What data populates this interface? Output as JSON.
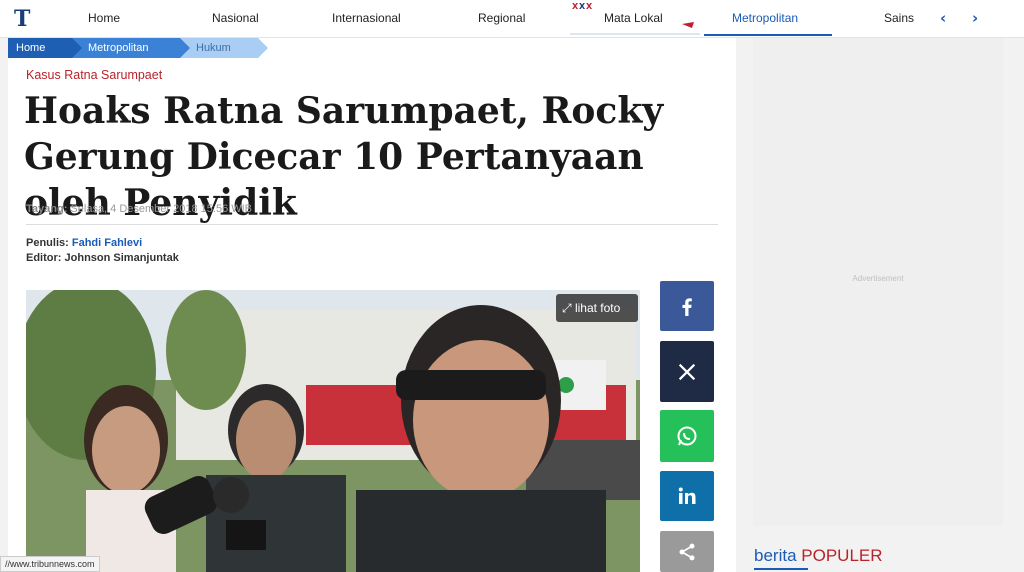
{
  "nav": {
    "items": [
      {
        "label": "Home"
      },
      {
        "label": "Nasional"
      },
      {
        "label": "Internasional"
      },
      {
        "label": "Regional"
      },
      {
        "label": "Mata Lokal"
      },
      {
        "label": "Metropolitan"
      },
      {
        "label": "Sains"
      }
    ],
    "active": "Metropolitan",
    "prev_icon": "chevron-left-icon",
    "next_icon": "chevron-right-icon"
  },
  "breadcrumb": [
    "Home",
    "Metropolitan",
    "Hukum"
  ],
  "article": {
    "kicker": "Kasus Ratna Sarumpaet",
    "headline": "Hoaks Ratna Sarumpaet, Rocky Gerung Dicecar 10 Pertanyaan oleh Penyidik",
    "tayang_label": "Tayang:",
    "tayang_value": "Selasa, 4 Desember 2018 15:56 WIB",
    "penulis_label": "Penulis:",
    "penulis_name": "Fahdi Fahlevi",
    "editor_label": "Editor:",
    "editor_name": "Johnson Simanjuntak",
    "lihat_foto": "lihat foto"
  },
  "share": [
    {
      "name": "facebook",
      "color": "#3b5998"
    },
    {
      "name": "x",
      "color": "#1f2a44"
    },
    {
      "name": "whatsapp",
      "color": "#25c05a"
    },
    {
      "name": "linkedin",
      "color": "#0f6fa8"
    },
    {
      "name": "share",
      "color": "#9a9a9a"
    }
  ],
  "sidebar": {
    "advertisement": "Advertisement",
    "popular_word1": "berita",
    "popular_word2": "POPULER"
  },
  "status_url": "//www.tribunnews.com",
  "colors": {
    "brand_blue": "#1a5bb8",
    "brand_red": "#b8232b"
  }
}
